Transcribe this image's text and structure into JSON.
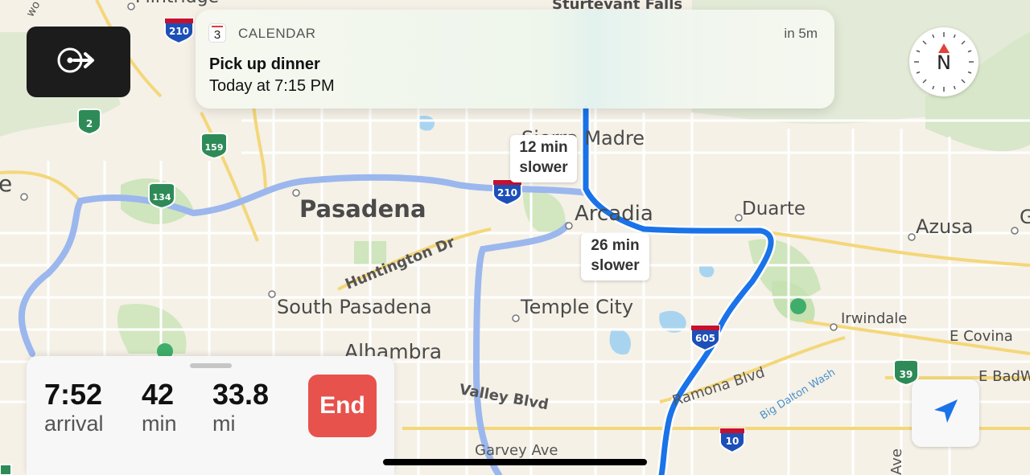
{
  "notification": {
    "app_name": "CALENDAR",
    "app_icon_day": "3",
    "time": "in 5m",
    "title": "Pick up dinner",
    "body": "Today at 7:15 PM"
  },
  "exit_button": {
    "icon": "exit-navigation-icon"
  },
  "compass": {
    "label": "N"
  },
  "callouts": {
    "alt1": {
      "line1": "12 min",
      "line2": "slower"
    },
    "alt2": {
      "line1": "26 min",
      "line2": "slower"
    }
  },
  "map_labels": {
    "cities": {
      "sturtevant_falls": "Sturtevant Falls",
      "sierra_madre": "Sierra Madre",
      "pasadena": "Pasadena",
      "arcadia": "Arcadia",
      "duarte": "Duarte",
      "azusa": "Azusa",
      "south_pasadena": "South Pasadena",
      "temple_city": "Temple City",
      "alhambra": "Alhambra",
      "irwindale": "Irwindale",
      "e_covina": "E Covina",
      "e_badw": "E BadW",
      "e_left": "e",
      "g_right": "G",
      "flintridge": "Flintridge"
    },
    "roads": {
      "huntington": "Huntington Dr",
      "valley": "Valley Blvd",
      "garvey": "Garvey Ave",
      "ramona": "Ramona Blvd",
      "big_dalton": "Big Dalton Wash",
      "ave": "Ave",
      "wo": "wo"
    },
    "shields": {
      "i210_top": "210",
      "i210_mid": "210",
      "ca2": "2",
      "ca159": "159",
      "ca134": "134",
      "i605": "605",
      "i10": "10",
      "ca39": "39"
    }
  },
  "trip": {
    "arrival_value": "7:52",
    "arrival_unit": "arrival",
    "duration_value": "42",
    "duration_unit": "min",
    "distance_value": "33.8",
    "distance_unit": "mi",
    "end_label": "End"
  },
  "location_button": {
    "icon": "location-arrow-icon"
  },
  "colors": {
    "main_route": "#1a73e8",
    "alt_route": "#9bb7ee",
    "end_button": "#e8524c",
    "park": "#c9e3b8",
    "water": "#a9d4f0"
  }
}
